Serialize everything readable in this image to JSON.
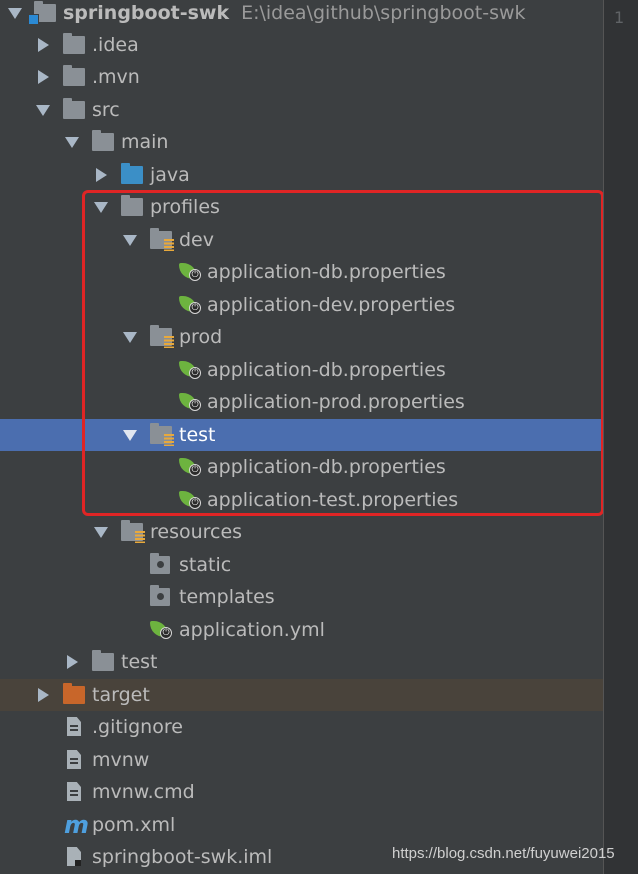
{
  "project": {
    "name": "springboot-swk",
    "path": "E:\\idea\\github\\springboot-swk"
  },
  "tree": {
    "idea": ".idea",
    "mvn": ".mvn",
    "src": "src",
    "main": "main",
    "java": "java",
    "profiles": "profiles",
    "dev": "dev",
    "dev_db": "application-db.properties",
    "dev_props": "application-dev.properties",
    "prod": "prod",
    "prod_db": "application-db.properties",
    "prod_props": "application-prod.properties",
    "test_profile": "test",
    "test_db": "application-db.properties",
    "test_props": "application-test.properties",
    "resources": "resources",
    "static": "static",
    "templates": "templates",
    "application_yml": "application.yml",
    "test": "test",
    "target": "target",
    "gitignore": ".gitignore",
    "mvnw": "mvnw",
    "mvnw_cmd": "mvnw.cmd",
    "pom": "pom.xml",
    "iml": "springboot-swk.iml"
  },
  "editor": {
    "line_number": "1"
  },
  "watermark": "https://blog.csdn.net/fuyuwei2015",
  "icons": {
    "folder": "folder-icon",
    "source_folder": "source-folder-icon",
    "resource_folder": "resource-folder-icon",
    "excluded_folder": "excluded-folder-icon",
    "spring_config": "spring-config-icon",
    "text_file": "text-file-icon",
    "maven": "maven-icon"
  },
  "colors": {
    "background": "#3c3f41",
    "selection": "#4b6eaf",
    "excluded_row": "#49433b",
    "highlight_box": "#e02525",
    "spring_green": "#6db33f"
  }
}
